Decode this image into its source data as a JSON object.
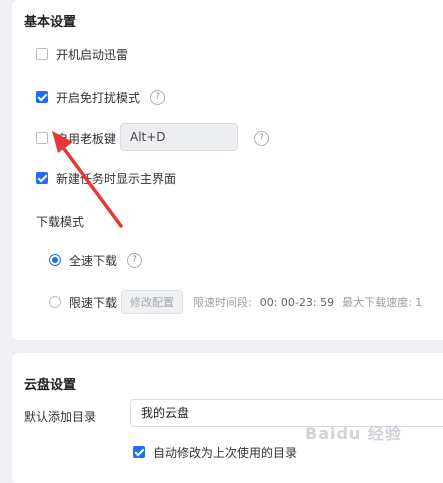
{
  "basic_settings": {
    "title": "基本设置",
    "launch_on_startup": {
      "label": "开机启动迅雷",
      "checked": false
    },
    "do_not_disturb": {
      "label": "开启免打扰模式",
      "checked": true
    },
    "boss_key": {
      "label": "启用老板键",
      "checked": false,
      "hotkey": "Alt+D"
    },
    "show_main_on_new_task": {
      "label": "新建任务时显示主界面",
      "checked": true
    },
    "download_mode": {
      "title": "下载模式",
      "full_speed": {
        "label": "全速下载",
        "selected": true
      },
      "limited_speed": {
        "label": "限速下载",
        "selected": false,
        "modify_button": "修改配置",
        "time_label": "限速时间段:",
        "time_value": "00: 00-23: 59",
        "max_speed_label": "最大下载速度: 1"
      }
    }
  },
  "cloud_settings": {
    "title": "云盘设置",
    "default_dir_label": "默认添加目录",
    "default_dir_value": "我的云盘",
    "auto_update_dir": {
      "label": "自动修改为上次使用的目录",
      "checked": true
    }
  },
  "help_icon_glyph": "?",
  "colors": {
    "accent": "#1e6ef5",
    "arrow": "#e53935"
  },
  "watermark": "Baidu 经验"
}
